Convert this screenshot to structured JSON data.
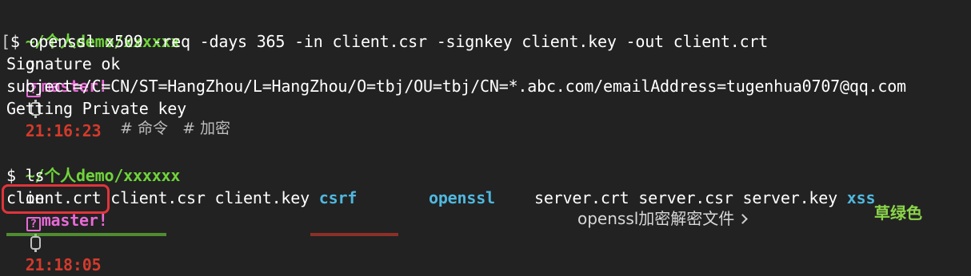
{
  "prompt1": {
    "path": "~/个人demo/xxxxxx",
    "on": "on",
    "branch_icon": "?",
    "branch": "master",
    "dirty": "!",
    "time": "21:16:23"
  },
  "command1": {
    "prefix": "$",
    "text": "openssl x509 -req -days 365 -in client.csr -signkey client.key -out client.crt"
  },
  "output1": [
    "Signature ok",
    "subject=/C=CN/ST=HangZhou/L=HangZhou/O=tbj/OU=tbj/CN=*.abc.com/emailAddress=tugenhua0707@qq.com",
    "Getting Private key"
  ],
  "tags": "# 命令   # 加密",
  "prompt2": {
    "path": "~/个人demo/xxxxxx",
    "on": "on",
    "branch_icon": "?",
    "branch": "master",
    "dirty": "!",
    "time": "21:18:05"
  },
  "command2": {
    "prefix": "$",
    "text": "ls"
  },
  "ls_output": {
    "f1": "client.crt",
    "f2": "client.csr",
    "f3": "client.key",
    "d1": "csrf",
    "d2": "openssl",
    "f4": "server.crt",
    "f5": "server.csr",
    "f6": "server.key",
    "d3": "xss"
  },
  "overlay": {
    "related_title": "openssl加密解密文件",
    "watermark": "草绿色"
  },
  "colors": {
    "background": "#222222",
    "path": "#6fd43b",
    "branch": "#e86ad8",
    "time": "#d33a2c",
    "directory": "#4fb8df",
    "highlight_box": "#e0353b"
  }
}
